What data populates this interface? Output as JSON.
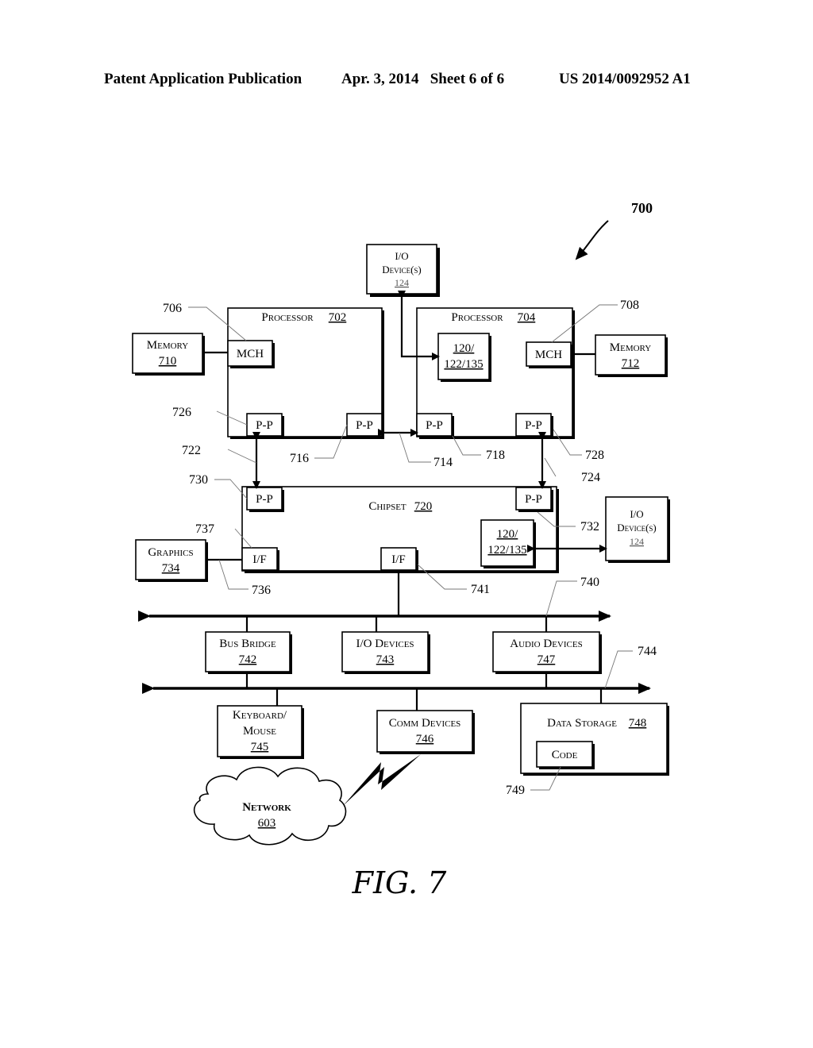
{
  "header": {
    "left": "Patent Application Publication",
    "center": "Apr. 3, 2014   Sheet 6 of 6",
    "right": "US 2014/0092952 A1"
  },
  "figure": {
    "ref": "700",
    "caption": "FIG. 7"
  },
  "blocks": {
    "io_top": {
      "line1": "I/O",
      "line2": "Device(s)",
      "num": "124"
    },
    "proc702": {
      "label": "Processor",
      "num": "702"
    },
    "proc704": {
      "label": "Processor",
      "num": "704"
    },
    "mem710": {
      "label": "Memory",
      "num": "710"
    },
    "mem712": {
      "label": "Memory",
      "num": "712"
    },
    "mch_a": {
      "label": "MCH"
    },
    "mch_b": {
      "label": "MCH"
    },
    "logic_a": {
      "line1": "120/",
      "line2": "122/135"
    },
    "logic_b": {
      "line1": "120/",
      "line2": "122/135"
    },
    "pp": {
      "label": "P-P"
    },
    "chipset": {
      "label": "Chipset",
      "num": "720"
    },
    "graphics": {
      "label": "Graphics",
      "num": "734"
    },
    "if": {
      "label": "I/F"
    },
    "io_right": {
      "line1": "I/O",
      "line2": "Device(s)",
      "num": "124"
    },
    "bus_bridge": {
      "label": "Bus Bridge",
      "num": "742"
    },
    "io_devices": {
      "label": "I/O Devices",
      "num": "743"
    },
    "audio": {
      "label": "Audio Devices",
      "num": "747"
    },
    "keyboard": {
      "line1": "Keyboard/",
      "line2": "Mouse",
      "num": "745"
    },
    "comm": {
      "label": "Comm Devices",
      "num": "746"
    },
    "storage": {
      "label": "Data Storage",
      "num": "748"
    },
    "code": {
      "label": "Code"
    },
    "network": {
      "label": "Network",
      "num": "603"
    }
  },
  "refs": {
    "r706": "706",
    "r708": "708",
    "r726": "726",
    "r722": "722",
    "r716": "716",
    "r714": "714",
    "r718": "718",
    "r728": "728",
    "r724": "724",
    "r730": "730",
    "r732": "732",
    "r737": "737",
    "r736": "736",
    "r741": "741",
    "r740": "740",
    "r744": "744",
    "r749": "749"
  }
}
